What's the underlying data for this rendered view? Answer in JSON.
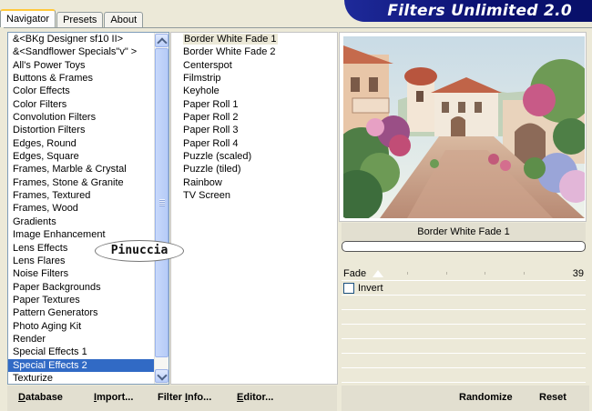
{
  "app_title": "Filters Unlimited 2.0",
  "tabs": [
    {
      "label": "Navigator",
      "active": true
    },
    {
      "label": "Presets",
      "active": false
    },
    {
      "label": "About",
      "active": false
    }
  ],
  "categories": [
    "&<BKg Designer sf10 II>",
    "&<Sandflower Specials\"v\" >",
    "All's Power Toys",
    "Buttons & Frames",
    "Color Effects",
    "Color Filters",
    "Convolution Filters",
    "Distortion Filters",
    "Edges, Round",
    "Edges, Square",
    "Frames, Marble & Crystal",
    "Frames, Stone & Granite",
    "Frames, Textured",
    "Frames, Wood",
    "Gradients",
    "Image Enhancement",
    "Lens Effects",
    "Lens Flares",
    "Noise Filters",
    "Paper Backgrounds",
    "Paper Textures",
    "Pattern Generators",
    "Photo Aging Kit",
    "Render",
    "Special Effects 1",
    "Special Effects 2",
    "Texturize"
  ],
  "selected_category_index": 25,
  "filters": [
    "Border White Fade 1",
    "Border White Fade 2",
    "Centerspot",
    "Filmstrip",
    "Keyhole",
    "Paper Roll 1",
    "Paper Roll 2",
    "Paper Roll 3",
    "Paper Roll 4",
    "Puzzle (scaled)",
    "Puzzle (tiled)",
    "Rainbow",
    "TV Screen"
  ],
  "selected_filter_index": 0,
  "preview": {
    "filter_name": "Border White Fade 1"
  },
  "params": {
    "fade_label": "Fade",
    "fade_value": "39",
    "invert_label": "Invert",
    "invert_checked": false
  },
  "buttons": {
    "database": {
      "u": "D",
      "rest": "atabase"
    },
    "import": {
      "u": "I",
      "rest": "mport..."
    },
    "filter_info": {
      "pre": "Filter ",
      "u": "I",
      "rest": "nfo..."
    },
    "editor": {
      "u": "E",
      "rest": "ditor..."
    },
    "randomize": "Randomize",
    "reset": "Reset"
  },
  "watermark": "Pinuccia",
  "colors": {
    "banner": "#0a0f6e",
    "selection": "#316ac5",
    "window_bg": "#ece9d8"
  }
}
